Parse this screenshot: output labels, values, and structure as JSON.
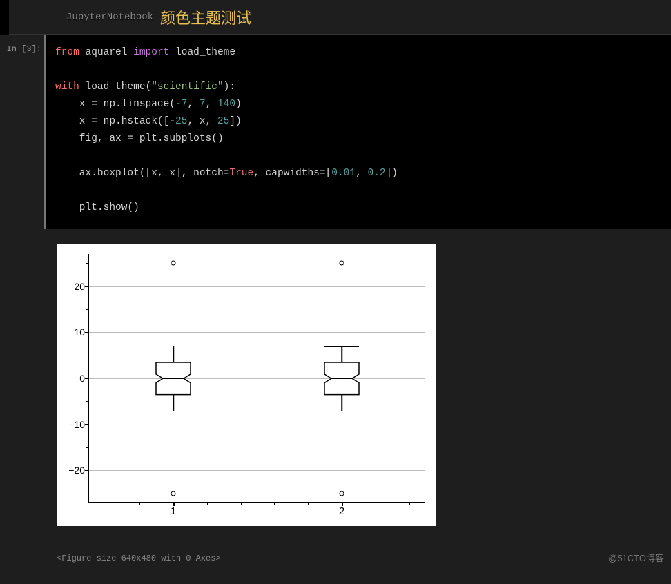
{
  "header": {
    "notebook_label": "JupyterNotebook",
    "title": "颜色主题测试"
  },
  "cell": {
    "prompt": "In [3]:",
    "code": {
      "l1_from": "from",
      "l1_module": " aquarel ",
      "l1_import": "import",
      "l1_name": " load_theme",
      "l3_with": "with",
      "l3_call": " load_theme(",
      "l3_str": "\"scientific\"",
      "l3_end": "):",
      "l4_a": "    x ",
      "l4_eq": "=",
      "l4_b": " np.linspace(",
      "l4_n1": "-7",
      "l4_c": ", ",
      "l4_n2": "7",
      "l4_d": ", ",
      "l4_n3": "140",
      "l4_e": ")",
      "l5_a": "    x ",
      "l5_eq": "=",
      "l5_b": " np.hstack([",
      "l5_n1": "-25",
      "l5_c": ", x, ",
      "l5_n2": "25",
      "l5_d": "])",
      "l6_a": "    fig, ax ",
      "l6_eq": "=",
      "l6_b": " plt.subplots()",
      "l8_a": "    ax.boxplot([x, x], notch",
      "l8_eq": "=",
      "l8_true": "True",
      "l8_b": ", capwidths",
      "l8_eq2": "=",
      "l8_c": "[",
      "l8_n1": "0.01",
      "l8_d": ", ",
      "l8_n2": "0.2",
      "l8_e": "])",
      "l10_a": "    plt.show()"
    }
  },
  "chart_data": {
    "type": "boxplot",
    "categories": [
      "1",
      "2"
    ],
    "series": [
      {
        "name": "1",
        "q1": -3.5,
        "median": 0,
        "q3": 3.5,
        "whisker_low": -7,
        "whisker_high": 7,
        "fliers": [
          -25,
          25
        ],
        "capwidth": 0.01,
        "notched": true
      },
      {
        "name": "2",
        "q1": -3.5,
        "median": 0,
        "q3": 3.5,
        "whisker_low": -7,
        "whisker_high": 7,
        "fliers": [
          -25,
          25
        ],
        "capwidth": 0.2,
        "notched": true
      }
    ],
    "ylim": [
      -27,
      27
    ],
    "yticks": [
      -20,
      -10,
      0,
      10,
      20
    ],
    "title": "",
    "xlabel": "",
    "ylabel": ""
  },
  "output": {
    "yticks": {
      "m20": "−20",
      "m10": "−10",
      "p0": "0",
      "p10": "10",
      "p20": "20"
    },
    "xticks": {
      "x1": "1",
      "x2": "2"
    },
    "figure_note": "<Figure size 640x480 with 0 Axes>"
  },
  "watermark": "@51CTO博客"
}
